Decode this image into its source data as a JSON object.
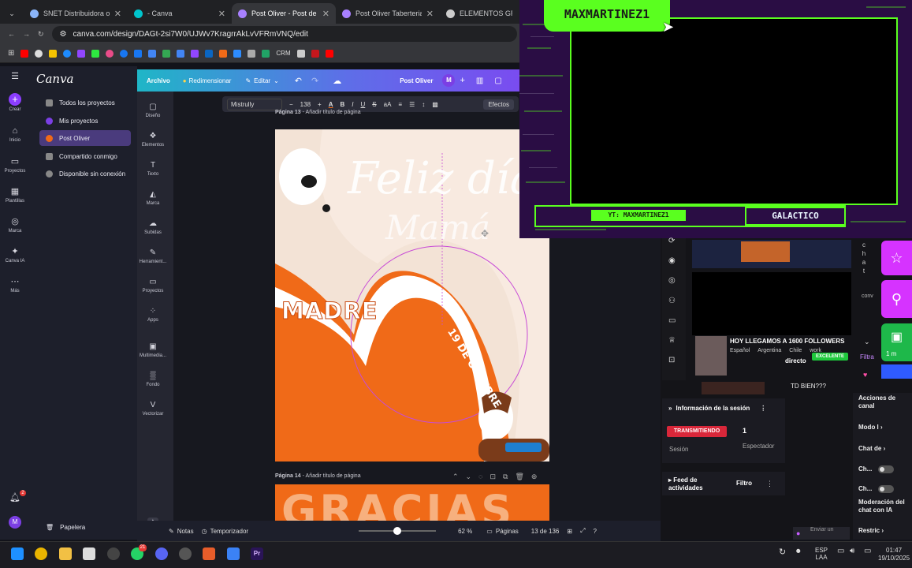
{
  "browser": {
    "tabs": [
      {
        "label": "SNET Distribuidora oliv",
        "active": false
      },
      {
        "label": "- Canva",
        "active": false
      },
      {
        "label": "Post Oliver - Post de In",
        "active": true
      },
      {
        "label": "Post Oliver Taberteria",
        "active": false
      },
      {
        "label": "ELEMENTOS GRAFICOS",
        "active": false
      }
    ],
    "url": "canva.com/design/DAGt-2si7W0/UJWv7KragrrAkLvVFRmVNQ/edit",
    "bookmarks": {
      "crm": "CRM"
    }
  },
  "canva": {
    "logo": "Canva",
    "rail": [
      {
        "icon": "plus-icon",
        "label": "Crear"
      },
      {
        "icon": "home-icon",
        "label": "Inicio"
      },
      {
        "icon": "folder-icon",
        "label": "Proyectos"
      },
      {
        "icon": "template-icon",
        "label": "Plantillas"
      },
      {
        "icon": "brand-icon",
        "label": "Marca"
      },
      {
        "icon": "sparkle-icon",
        "label": "Canva IA"
      },
      {
        "icon": "more-icon",
        "label": "Más"
      }
    ],
    "nav": [
      {
        "label": "Todos los proyectos",
        "selected": false
      },
      {
        "label": "Mis proyectos",
        "selected": false
      },
      {
        "label": "Post Oliver",
        "selected": true
      },
      {
        "label": "Compartido conmigo",
        "selected": false
      },
      {
        "label": "Disponible sin conexión",
        "selected": false
      }
    ],
    "papelera": "Papelera",
    "header": {
      "archivo": "Archivo",
      "redimensionar": "Redimensionar",
      "editar": "Editar",
      "title": "Post Oliver",
      "avatar": "M"
    },
    "tools": [
      {
        "icon": "design-icon",
        "label": "Diseño"
      },
      {
        "icon": "elements-icon",
        "label": "Elementos"
      },
      {
        "icon": "text-icon",
        "label": "Texto"
      },
      {
        "icon": "brand-icon",
        "label": "Marca"
      },
      {
        "icon": "upload-icon",
        "label": "Subidas"
      },
      {
        "icon": "tools-icon",
        "label": "Herramient..."
      },
      {
        "icon": "folder-icon",
        "label": "Proyectos"
      },
      {
        "icon": "apps-icon",
        "label": "Apps"
      },
      {
        "icon": "media-icon",
        "label": "Multimedia..."
      },
      {
        "icon": "background-icon",
        "label": "Fondo"
      },
      {
        "icon": "vector-icon",
        "label": "Vectorizar"
      }
    ],
    "format": {
      "font": "Mistrully",
      "size": "138",
      "efectos": "Efectos"
    },
    "page13": {
      "label": "Página 13",
      "sub": "- Añadir título de página"
    },
    "design": {
      "script1": "Feliz día",
      "script2": "Mamá",
      "madre": "MADRE",
      "date": "19 DE OCTUBRE"
    },
    "page14": {
      "label": "Página 14",
      "sub": "- Añadir título de página",
      "text": "GRACIAS"
    },
    "bottom": {
      "notas": "Notas",
      "temporizador": "Temporizador",
      "zoom": "62 %",
      "paginas": "Páginas",
      "pagecount": "13 de 136"
    }
  },
  "overlay": {
    "username": "MAXMARTINEZ1",
    "yt": "YT: MAXMARTINEZ1",
    "rank": "GALACTICO"
  },
  "stream": {
    "title": "HOY LLEGAMOS A 1600 FOLLOWERS",
    "tags": [
      "Español",
      "Argentina",
      "Chile",
      "work"
    ],
    "live": "directo",
    "badge": "EXCELENTE",
    "filter": "Filtra",
    "chat": "TD BIEN???",
    "sidechat": "conv",
    "session_title": "Información de la sesión",
    "status": "TRANSMITIENDO",
    "session": "Sesión",
    "viewers": "1",
    "viewers_label": "Espectador",
    "feed": "Feed de actividades",
    "filtro": "Filtro",
    "actions": "Acciones de canal",
    "modo": "Modo l",
    "chatde": "Chat de",
    "ch1": "Ch...",
    "ch2": "Ch...",
    "mod": "Moderación del chat con IA",
    "restric": "Restric",
    "enviar": "Enviar un",
    "time_badge": "1 m"
  },
  "taskbar": {
    "lang1": "ESP",
    "lang2": "LAA",
    "time": "01:47",
    "date": "19/10/2025",
    "notif": "21",
    "notif2": "2"
  }
}
